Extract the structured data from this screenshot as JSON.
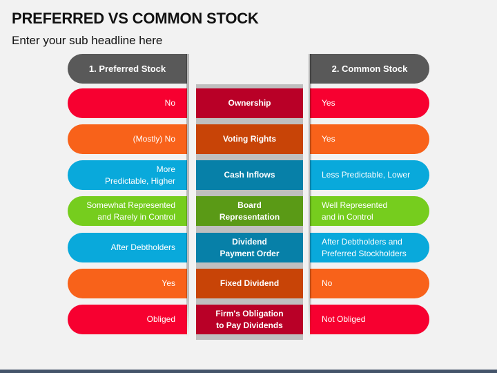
{
  "title": "PREFERRED VS COMMON STOCK",
  "subtitle": "Enter your sub headline here",
  "columns": {
    "left_header": "1. Preferred Stock",
    "right_header": "2. Common Stock"
  },
  "colors": {
    "header": "#595959",
    "red": "#f70030",
    "red_center": "#b90027",
    "orange": "#f8621a",
    "orange_center": "#c84407",
    "blue": "#09a9db",
    "blue_center": "#0780a8",
    "green": "#76cd1e",
    "green_center": "#5a9a16",
    "footer": "#44546a"
  },
  "rows": [
    {
      "criterion": "Ownership",
      "preferred": "No",
      "common": "Yes",
      "color": "red"
    },
    {
      "criterion": "Voting Rights",
      "preferred": "(Mostly) No",
      "common": "Yes",
      "color": "orange"
    },
    {
      "criterion": "Cash Inflows",
      "preferred": "More\nPredictable, Higher",
      "common": "Less Predictable, Lower",
      "color": "blue"
    },
    {
      "criterion": "Board\nRepresentation",
      "preferred": "Somewhat Represented\nand Rarely in Control",
      "common": "Well Represented\nand in Control",
      "color": "green"
    },
    {
      "criterion": "Dividend\nPayment Order",
      "preferred": "After Debtholders",
      "common": "After Debtholders and\nPreferred Stockholders",
      "color": "blue"
    },
    {
      "criterion": "Fixed Dividend",
      "preferred": "Yes",
      "common": "No",
      "color": "orange"
    },
    {
      "criterion": "Firm's Obligation\nto Pay Dividends",
      "preferred": "Obliged",
      "common": "Not Obliged",
      "color": "red"
    }
  ]
}
